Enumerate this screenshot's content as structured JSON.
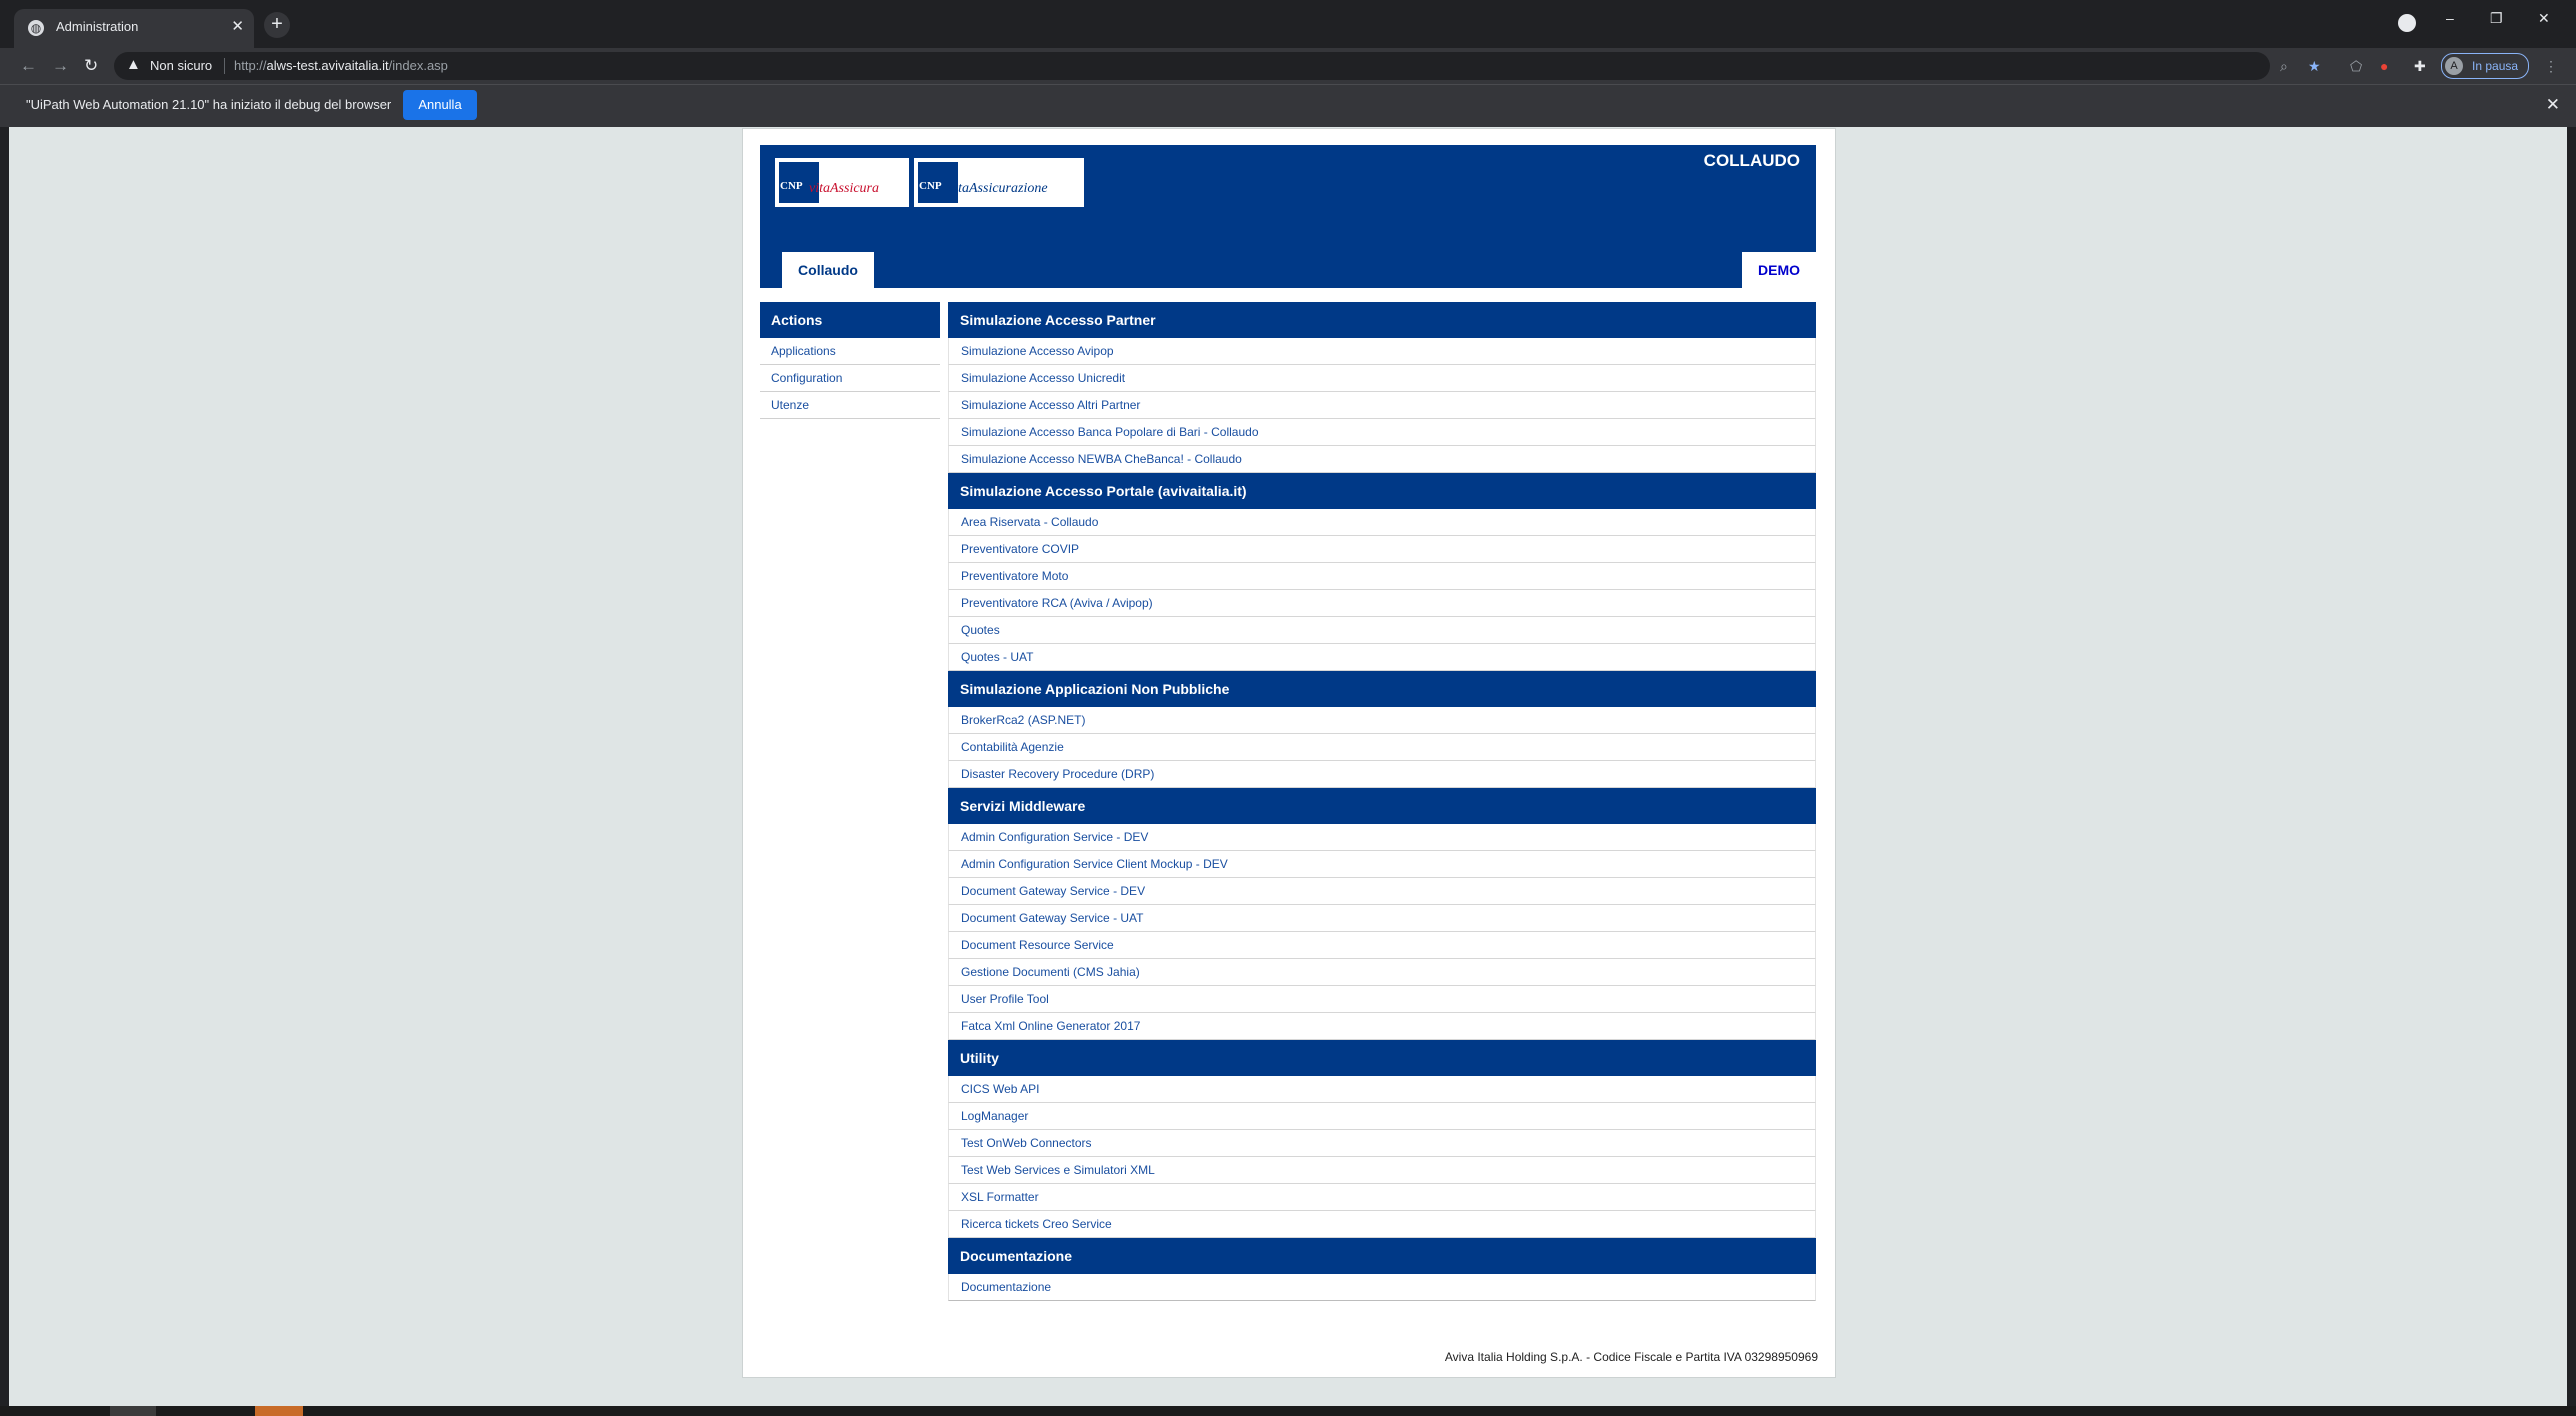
{
  "browser": {
    "tab_title": "Administration",
    "address_security": "Non sicuro",
    "url_prefix": "http://",
    "url_host": "alws-test.avivaitalia.it",
    "url_path": "/index.asp",
    "profile_initial": "A",
    "profile_status": "In pausa"
  },
  "infobar": {
    "message": "\"UiPath Web Automation 21.10\" ha iniziato il debug del browser",
    "cancel_label": "Annulla"
  },
  "header": {
    "environment": "COLLAUDO",
    "logo1": {
      "cnp": "CNP",
      "script": "vitaAssicura"
    },
    "logo2": {
      "cnp": "CNP",
      "script": "vitaAssicurazione"
    },
    "tab_left": "Collaudo",
    "tab_right": "DEMO"
  },
  "sidebar": {
    "title": "Actions",
    "items": [
      "Applications",
      "Configuration",
      "Utenze"
    ]
  },
  "sections": [
    {
      "title": "Simulazione Accesso Partner",
      "links": [
        "Simulazione Accesso Avipop",
        "Simulazione Accesso Unicredit",
        "Simulazione Accesso Altri Partner",
        "Simulazione Accesso Banca Popolare di Bari - Collaudo",
        "Simulazione Accesso NEWBA CheBanca! - Collaudo"
      ]
    },
    {
      "title": "Simulazione Accesso Portale (avivaitalia.it)",
      "links": [
        "Area Riservata - Collaudo",
        "Preventivatore COVIP",
        "Preventivatore Moto",
        "Preventivatore RCA (Aviva / Avipop)",
        "Quotes",
        "Quotes - UAT"
      ]
    },
    {
      "title": "Simulazione Applicazioni Non Pubbliche",
      "links": [
        "BrokerRca2 (ASP.NET)",
        "Contabilità Agenzie",
        "Disaster Recovery Procedure (DRP)"
      ]
    },
    {
      "title": "Servizi Middleware",
      "links": [
        "Admin Configuration Service - DEV",
        "Admin Configuration Service Client Mockup - DEV",
        "Document Gateway Service - DEV",
        "Document Gateway Service - UAT",
        "Document Resource Service",
        "Gestione Documenti (CMS Jahia)",
        "User Profile Tool",
        "Fatca Xml Online Generator 2017"
      ]
    },
    {
      "title": "Utility",
      "links": [
        "CICS Web API",
        "LogManager",
        "Test OnWeb Connectors",
        "Test Web Services e Simulatori XML",
        "XSL Formatter",
        "Ricerca tickets Creo Service"
      ]
    },
    {
      "title": "Documentazione",
      "links": [
        "Documentazione"
      ]
    }
  ],
  "footer": "Aviva Italia Holding S.p.A. - Codice Fiscale e Partita IVA 03298950969"
}
